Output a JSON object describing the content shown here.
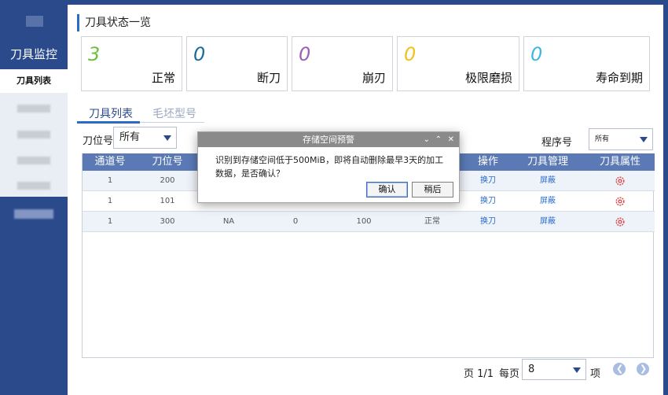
{
  "sidebar": {
    "title": "刀具监控",
    "active_item": "刀具列表"
  },
  "status": {
    "section_title": "刀具状态一览",
    "cards": [
      {
        "count": "3",
        "label": "正常",
        "color": "#6cbf3e"
      },
      {
        "count": "0",
        "label": "断刀",
        "color": "#1d6b9e"
      },
      {
        "count": "0",
        "label": "崩刃",
        "color": "#9b5fb8"
      },
      {
        "count": "0",
        "label": "极限磨损",
        "color": "#f2c21b"
      },
      {
        "count": "0",
        "label": "寿命到期",
        "color": "#3fb6e8"
      }
    ]
  },
  "tabs": {
    "active": "刀具列表",
    "inactive": "毛坯型号"
  },
  "filters": {
    "tool_pos_label": "刀位号",
    "tool_pos_value": "所有",
    "program_label": "程序号",
    "program_value": "所有"
  },
  "table": {
    "headers": [
      "通道号",
      "刀位号",
      "",
      "",
      "",
      "",
      "操作",
      "刀具管理",
      "刀具属性"
    ],
    "rows": [
      {
        "channel": "1",
        "pos": "200",
        "c3": "",
        "c4": "",
        "c5": "",
        "c6": "",
        "op": "换刀",
        "manage": "屏蔽"
      },
      {
        "channel": "1",
        "pos": "101",
        "c3": "",
        "c4": "",
        "c5": "",
        "c6": "",
        "op": "换刀",
        "manage": "屏蔽"
      },
      {
        "channel": "1",
        "pos": "300",
        "c3": "NA",
        "c4": "0",
        "c5": "100",
        "c6": "正常",
        "op": "换刀",
        "manage": "屏蔽"
      }
    ]
  },
  "pagination": {
    "page_text": "页 1/1",
    "per_page_label": "每页",
    "per_page_value": "8",
    "unit": "项"
  },
  "modal": {
    "title": "存储空间预警",
    "message": "识别到存储空间低于500MiB，即将自动删除最早3天的加工数据，是否确认？",
    "confirm": "确认",
    "later": "稍后"
  }
}
